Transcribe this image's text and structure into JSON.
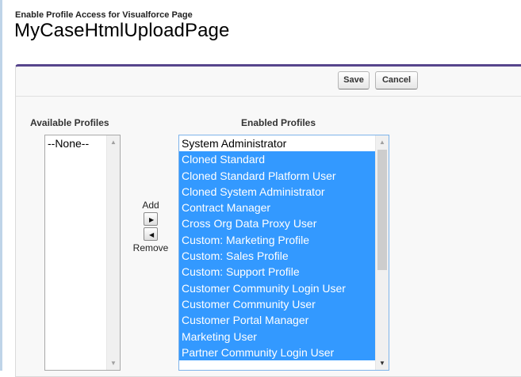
{
  "header": {
    "subtitle": "Enable Profile Access for Visualforce Page",
    "title": "MyCaseHtmlUploadPage"
  },
  "buttons": {
    "save": "Save",
    "cancel": "Cancel"
  },
  "available": {
    "label": "Available Profiles",
    "options": [
      "--None--"
    ]
  },
  "enabled": {
    "label": "Enabled Profiles",
    "options": [
      "System Administrator",
      "Cloned Standard",
      "Cloned Standard Platform User",
      "Cloned System Administrator",
      "Contract Manager",
      "Cross Org Data Proxy User",
      "Custom: Marketing Profile",
      "Custom: Sales Profile",
      "Custom: Support Profile",
      "Customer Community Login User",
      "Customer Community User",
      "Customer Portal Manager",
      "Marketing User",
      "Partner Community Login User"
    ]
  },
  "controls": {
    "add": "Add",
    "remove": "Remove",
    "add_icon": "right-triangle",
    "remove_icon": "left-triangle"
  },
  "colors": {
    "selection": "#3399ff",
    "panel_accent": "#56458c"
  }
}
